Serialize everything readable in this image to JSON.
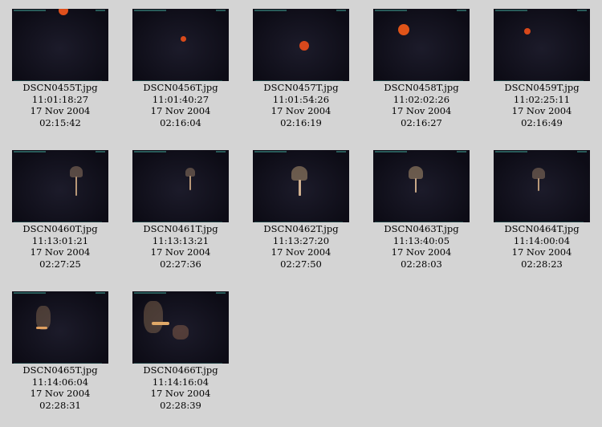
{
  "items": [
    {
      "file": "DSCN0455T.jpg",
      "time": "11:01:18:27",
      "date": "17 Nov 2004",
      "elapsed": "02:15:42"
    },
    {
      "file": "DSCN0456T.jpg",
      "time": "11:01:40:27",
      "date": "17 Nov 2004",
      "elapsed": "02:16:04"
    },
    {
      "file": "DSCN0457T.jpg",
      "time": "11:01:54:26",
      "date": "17 Nov 2004",
      "elapsed": "02:16:19"
    },
    {
      "file": "DSCN0458T.jpg",
      "time": "11:02:02:26",
      "date": "17 Nov 2004",
      "elapsed": "02:16:27"
    },
    {
      "file": "DSCN0459T.jpg",
      "time": "11:02:25:11",
      "date": "17 Nov 2004",
      "elapsed": "02:16:49"
    },
    {
      "file": "DSCN0460T.jpg",
      "time": "11:13:01:21",
      "date": "17 Nov 2004",
      "elapsed": "02:27:25"
    },
    {
      "file": "DSCN0461T.jpg",
      "time": "11:13:13:21",
      "date": "17 Nov 2004",
      "elapsed": "02:27:36"
    },
    {
      "file": "DSCN0462T.jpg",
      "time": "11:13:27:20",
      "date": "17 Nov 2004",
      "elapsed": "02:27:50"
    },
    {
      "file": "DSCN0463T.jpg",
      "time": "11:13:40:05",
      "date": "17 Nov 2004",
      "elapsed": "02:28:03"
    },
    {
      "file": "DSCN0464T.jpg",
      "time": "11:14:00:04",
      "date": "17 Nov 2004",
      "elapsed": "02:28:23"
    },
    {
      "file": "DSCN0465T.jpg",
      "time": "11:14:06:04",
      "date": "17 Nov 2004",
      "elapsed": "02:28:31"
    },
    {
      "file": "DSCN0466T.jpg",
      "time": "11:14:16:04",
      "date": "17 Nov 2004",
      "elapsed": "02:28:39"
    }
  ]
}
